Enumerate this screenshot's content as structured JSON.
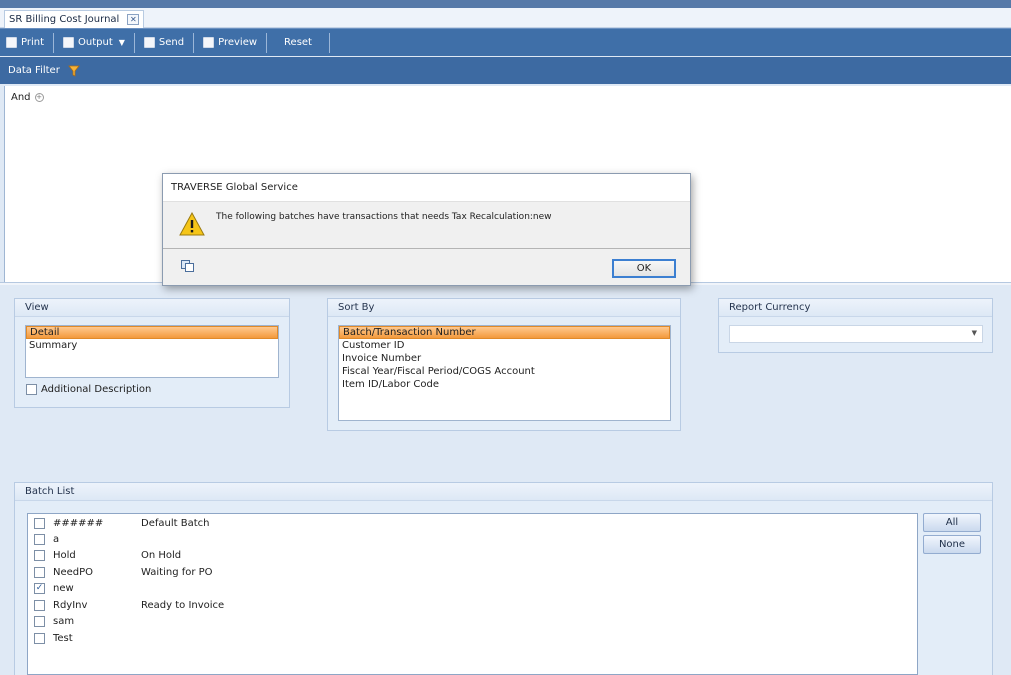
{
  "tab": {
    "title": "SR Billing Cost Journal",
    "close": "✕"
  },
  "toolbar": {
    "print": "Print",
    "output": "Output",
    "send": "Send",
    "preview": "Preview",
    "reset": "Reset"
  },
  "filter": {
    "label": "Data Filter",
    "and": "And"
  },
  "view": {
    "title": "View",
    "items": [
      {
        "label": "Detail",
        "selected": true
      },
      {
        "label": "Summary",
        "selected": false
      }
    ],
    "additional_description": "Additional Description"
  },
  "sort_by": {
    "title": "Sort By",
    "items": [
      {
        "label": "Batch/Transaction Number",
        "selected": true
      },
      {
        "label": "Customer ID",
        "selected": false
      },
      {
        "label": "Invoice Number",
        "selected": false
      },
      {
        "label": "Fiscal Year/Fiscal Period/COGS Account",
        "selected": false
      },
      {
        "label": "Item ID/Labor Code",
        "selected": false
      }
    ]
  },
  "report_currency": {
    "title": "Report Currency",
    "value": ""
  },
  "batch_list": {
    "title": "Batch List",
    "rows": [
      {
        "id": "######",
        "desc": "Default Batch",
        "checked": false
      },
      {
        "id": "a",
        "desc": "",
        "checked": false
      },
      {
        "id": "Hold",
        "desc": "On Hold",
        "checked": false
      },
      {
        "id": "NeedPO",
        "desc": "Waiting for PO",
        "checked": false
      },
      {
        "id": "new",
        "desc": "",
        "checked": true
      },
      {
        "id": "RdyInv",
        "desc": "Ready to Invoice",
        "checked": false
      },
      {
        "id": "sam",
        "desc": "",
        "checked": false
      },
      {
        "id": "Test",
        "desc": "",
        "checked": false
      }
    ],
    "all_label": "All",
    "none_label": "None"
  },
  "dialog": {
    "title": "TRAVERSE Global Service",
    "message": "The following batches have transactions that needs Tax Recalculation:new",
    "ok": "OK"
  }
}
